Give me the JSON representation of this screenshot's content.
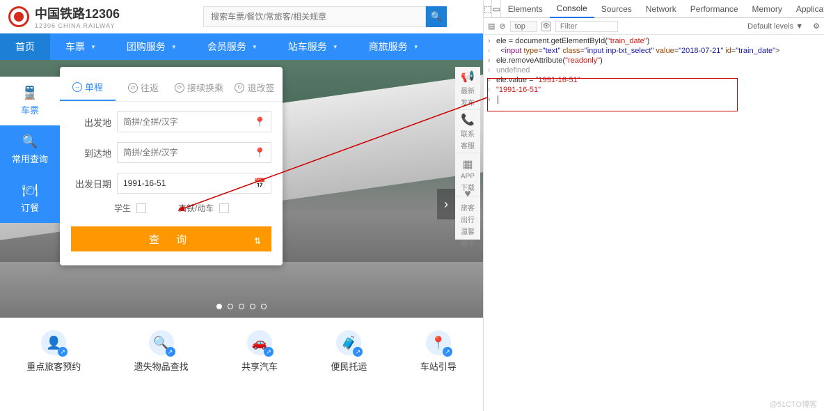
{
  "header": {
    "title_main": "中国铁路12306",
    "title_sub": "12306 CHINA RAILWAY",
    "search_placeholder": "搜索车票/餐饮/常旅客/相关规章"
  },
  "nav": [
    {
      "label": "首页",
      "dd": false,
      "active": true
    },
    {
      "label": "车票",
      "dd": true
    },
    {
      "label": "团购服务",
      "dd": true
    },
    {
      "label": "会员服务",
      "dd": true
    },
    {
      "label": "站车服务",
      "dd": true
    },
    {
      "label": "商旅服务",
      "dd": true
    }
  ],
  "side_tabs": [
    {
      "icon": "🚆",
      "label": "车票"
    },
    {
      "icon": "🔍",
      "label": "常用查询"
    },
    {
      "icon": "🍽",
      "label": "订餐"
    }
  ],
  "card_tabs": [
    {
      "icon": "→",
      "label": "单程",
      "active": true
    },
    {
      "icon": "⇄",
      "label": "往返"
    },
    {
      "icon": "⟳",
      "label": "接续换乘"
    },
    {
      "icon": "↻",
      "label": "退改签"
    }
  ],
  "form": {
    "from_label": "出发地",
    "from_ph": "简拼/全拼/汉字",
    "to_label": "到达地",
    "to_ph": "简拼/全拼/汉字",
    "date_label": "出发日期",
    "date_value": "1991-16-51",
    "student": "学生",
    "gdc": "高铁/动车",
    "query": "查 询"
  },
  "float_icons": [
    {
      "icon": "📢",
      "t1": "最新",
      "t2": "发布"
    },
    {
      "icon": "📞",
      "t1": "联系",
      "t2": "客服"
    },
    {
      "icon": "▦",
      "t1": "APP",
      "t2": "下载"
    },
    {
      "icon": "♥",
      "t1": "旅客",
      "t2": "出行",
      "t3": "温馨",
      "t4": "提示"
    }
  ],
  "quick_links": [
    {
      "icon": "👤",
      "label": "重点旅客预约"
    },
    {
      "icon": "🔍",
      "label": "遗失物品查找"
    },
    {
      "icon": "🚗",
      "label": "共享汽车"
    },
    {
      "icon": "🧳",
      "label": "便民托运"
    },
    {
      "icon": "📍",
      "label": "车站引导"
    }
  ],
  "devtools": {
    "tabs": [
      "Elements",
      "Console",
      "Sources",
      "Network",
      "Performance",
      "Memory",
      "Application"
    ],
    "active_tab": "Console",
    "context": "top",
    "filter_ph": "Filter",
    "levels": "Default levels ▼",
    "lines": [
      {
        "type": "prompt",
        "html": "ele = document.getElementById(<span class='str'>\"train_date\"</span>)"
      },
      {
        "type": "result",
        "html": "  &lt;<span class='tag'>input</span> <span class='attr'>type</span>=<span class='val'>\"text\"</span> <span class='attr'>class</span>=<span class='val'>\"input inp-txt_select\"</span> <span class='attr'>value</span>=<span class='val'>\"2018-07-21\"</span> <span class='attr'>id</span>=<span class='val'>\"train_date\"</span>&gt;"
      },
      {
        "type": "prompt",
        "html": "ele.removeAttribute(<span class='str'>\"readonly\"</span>)"
      },
      {
        "type": "result",
        "html": "<span class='undef'>undefined</span>"
      },
      {
        "type": "prompt",
        "html": "ele.value = <span class='str'>\"1991-16-51\"</span>"
      },
      {
        "type": "result",
        "html": "<span class='str'>\"1991-16-51\"</span>"
      },
      {
        "type": "prompt",
        "html": "<span style='border-left:1px solid #333;display:inline-block;height:12px;margin-left:2px'></span>"
      }
    ]
  },
  "watermark": "@51CTO博客"
}
